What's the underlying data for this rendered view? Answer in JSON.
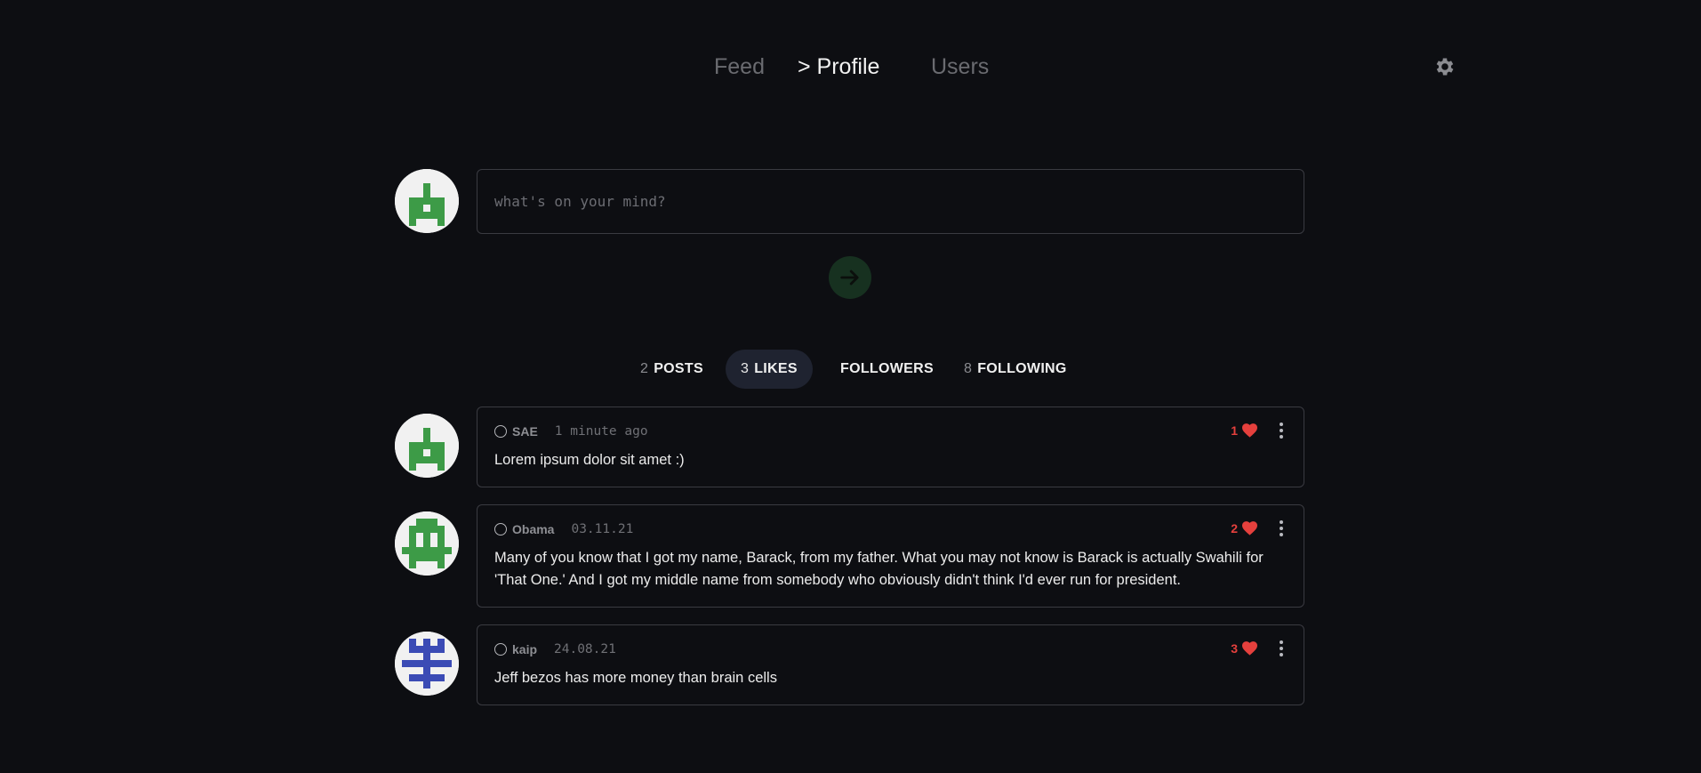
{
  "nav": {
    "feed": "Feed",
    "profile": "> Profile",
    "users": "Users"
  },
  "icons": {
    "settings": "gear-icon",
    "send": "arrow-right-icon",
    "like": "heart-icon",
    "more": "more-vertical-icon",
    "status": "circle-outline-icon"
  },
  "colors": {
    "background": "#0d0e12",
    "accent_green": "#3d9b47",
    "avatar_blue": "#3b4bb5",
    "like_red": "#e5403d",
    "active_tab": "#1f2330"
  },
  "composer": {
    "placeholder": "what's on your mind?",
    "value": ""
  },
  "tabs": [
    {
      "count": "2",
      "label": "POSTS",
      "active": false
    },
    {
      "count": "3",
      "label": "LIKES",
      "active": true
    },
    {
      "count": "",
      "label": "FOLLOWERS",
      "active": false
    },
    {
      "count": "8",
      "label": "FOLLOWING",
      "active": false
    }
  ],
  "posts": [
    {
      "author": "SAE",
      "time": "1 minute ago",
      "likes": "1",
      "text": "Lorem ipsum dolor sit amet :)"
    },
    {
      "author": "Obama",
      "time": "03.11.21",
      "likes": "2",
      "text": "Many of you know that I got my name, Barack, from my father. What you may not know is Barack is actually Swahili for 'That One.' And I got my middle name from somebody who obviously didn't think I'd ever run for president."
    },
    {
      "author": "kaip",
      "time": "24.08.21",
      "likes": "3",
      "text": "Jeff bezos has more money than brain cells"
    }
  ]
}
